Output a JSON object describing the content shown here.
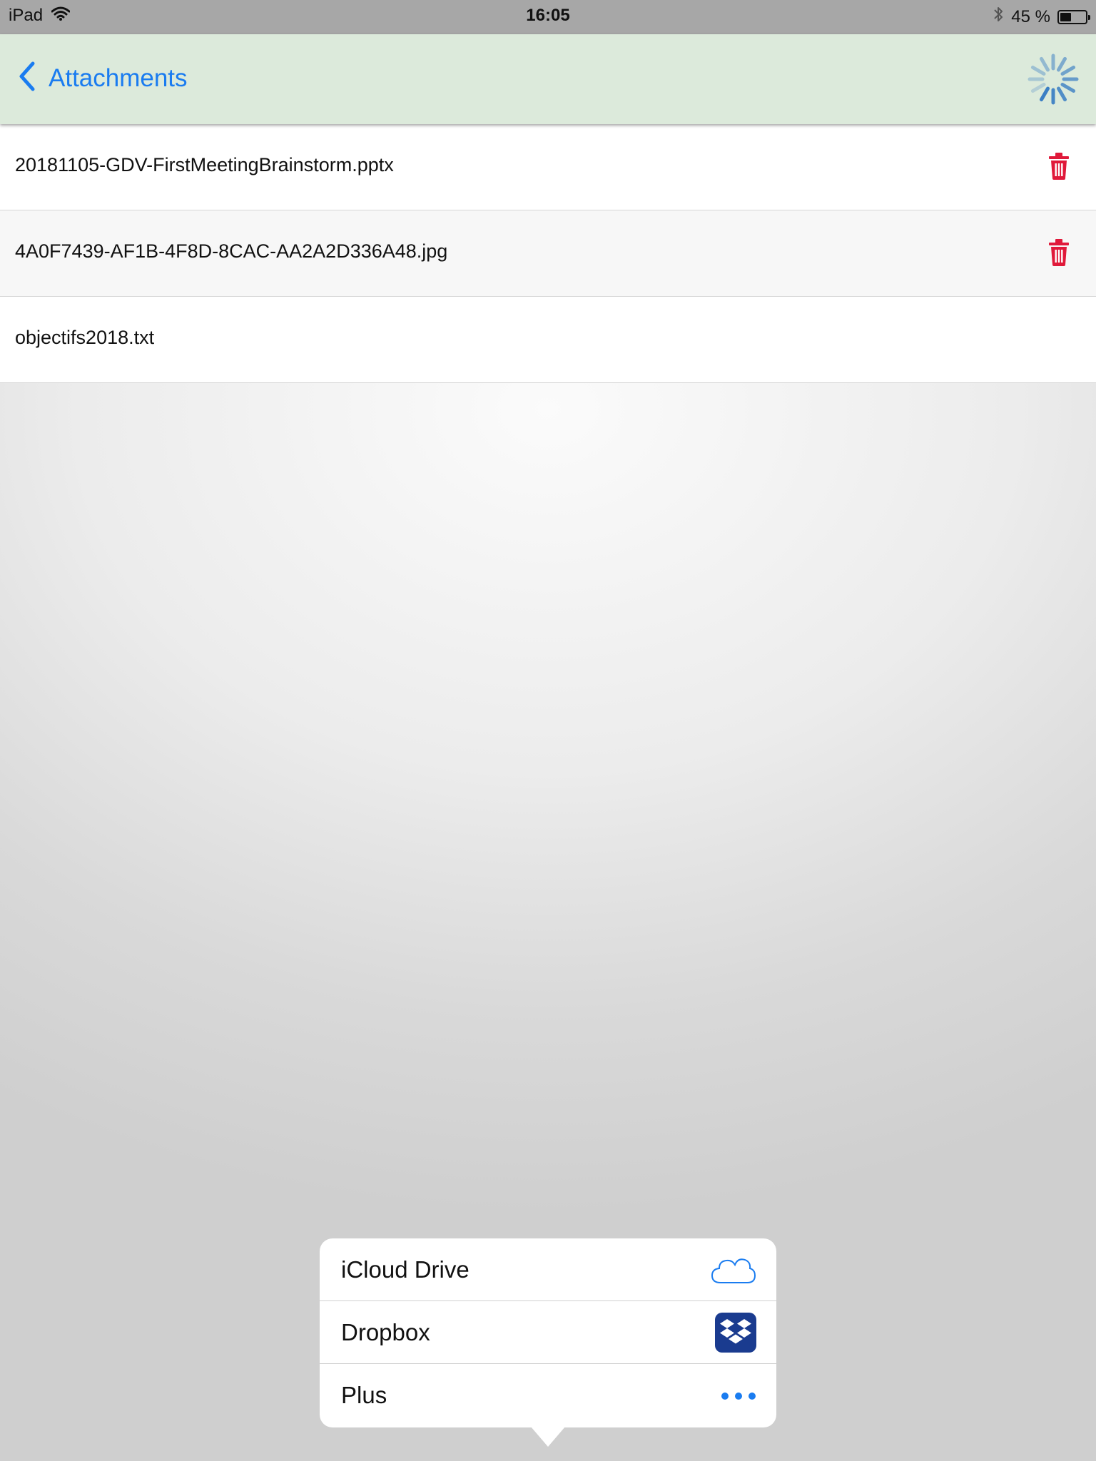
{
  "status_bar": {
    "device": "iPad",
    "time": "16:05",
    "battery_text": "45 %",
    "battery_level": 0.45
  },
  "nav": {
    "back_label": "Attachments"
  },
  "attachments": [
    {
      "name": "20181105-GDV-FirstMeetingBrainstorm.pptx",
      "deletable": true
    },
    {
      "name": "4A0F7439-AF1B-4F8D-8CAC-AA2A2D336A48.jpg",
      "deletable": true
    },
    {
      "name": "objectifs2018.txt",
      "deletable": false
    }
  ],
  "popover": {
    "items": [
      {
        "label": "iCloud Drive",
        "icon": "cloud-icon"
      },
      {
        "label": "Dropbox",
        "icon": "dropbox-icon"
      },
      {
        "label": "Plus",
        "icon": "ellipsis-icon"
      }
    ]
  },
  "colors": {
    "accent": "#1a7cf0",
    "nav_background": "#dceadb",
    "delete": "#e0193a",
    "dropbox": "#1a3b8f"
  }
}
